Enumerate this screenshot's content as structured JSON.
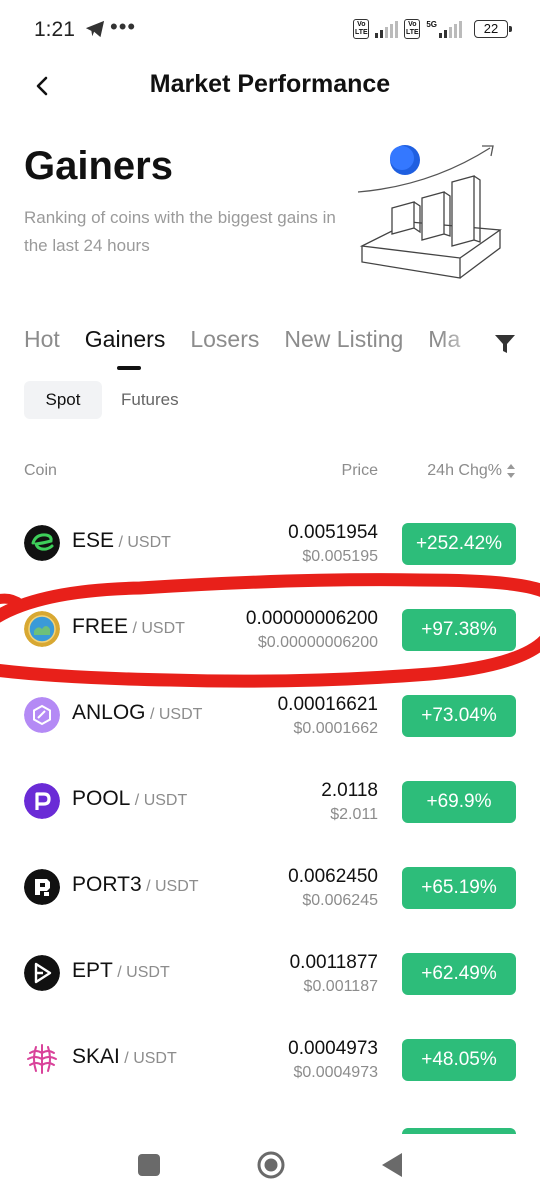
{
  "status_bar": {
    "time": "1:21",
    "dots": "•••",
    "volte1": "Vo LTE",
    "volte2": "Vo LTE",
    "network": "5G",
    "battery": "22"
  },
  "header": {
    "title": "Market Performance"
  },
  "hero": {
    "title": "Gainers",
    "description": "Ranking of coins with the biggest gains in the last 24 hours"
  },
  "tabs": [
    "Hot",
    "Gainers",
    "Losers",
    "New Listing",
    "Ma"
  ],
  "active_tab": "Gainers",
  "subtabs": {
    "spot": "Spot",
    "futures": "Futures"
  },
  "columns": {
    "coin": "Coin",
    "price": "Price",
    "change": "24h Chg%"
  },
  "rows": [
    {
      "symbol": "ESE",
      "quote": " / USDT",
      "price": "0.0051954",
      "usd": "$0.005195",
      "change": "+252.42%"
    },
    {
      "symbol": "FREE",
      "quote": " / USDT",
      "price": "0.00000006200",
      "usd": "$0.00000006200",
      "change": "+97.38%"
    },
    {
      "symbol": "ANLOG",
      "quote": " / USDT",
      "price": "0.00016621",
      "usd": "$0.0001662",
      "change": "+73.04%"
    },
    {
      "symbol": "POOL",
      "quote": " / USDT",
      "price": "2.0118",
      "usd": "$2.011",
      "change": "+69.9%"
    },
    {
      "symbol": "PORT3",
      "quote": " / USDT",
      "price": "0.0062450",
      "usd": "$0.006245",
      "change": "+65.19%"
    },
    {
      "symbol": "EPT",
      "quote": " / USDT",
      "price": "0.0011877",
      "usd": "$0.001187",
      "change": "+62.49%"
    },
    {
      "symbol": "SKAI",
      "quote": " / USDT",
      "price": "0.0004973",
      "usd": "$0.0004973",
      "change": "+48.05%"
    }
  ],
  "colors": {
    "gain": "#2dbd7a",
    "annotation": "#e8201a",
    "muted": "#8c8c8c"
  },
  "icons": {
    "back": "chevron-left-icon",
    "filter": "filter-icon",
    "sort": "sort-icon",
    "nav_recents": "square-icon",
    "nav_home": "circle-icon",
    "nav_back": "triangle-back-icon"
  }
}
